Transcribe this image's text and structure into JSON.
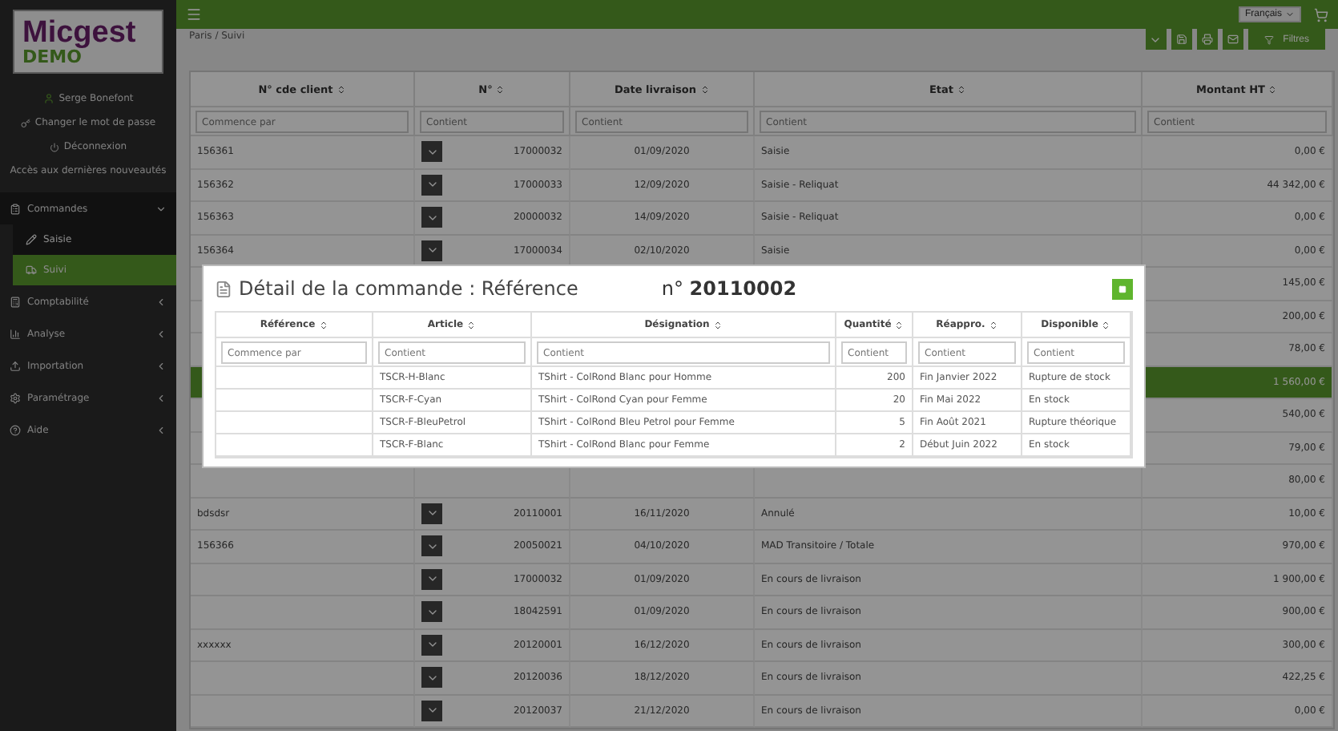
{
  "sidebar": {
    "logo": {
      "name": "Micgest",
      "sub": "DEMO"
    },
    "user": "Serge Bonefont",
    "links": [
      "Changer le mot de passe",
      "Déconnexion"
    ],
    "note": "Accès aux dernières nouveautés",
    "items": [
      {
        "label": "Commandes",
        "expanded": true,
        "children": [
          {
            "label": "Saisie",
            "selected": false
          },
          {
            "label": "Suivi",
            "selected": true
          }
        ]
      },
      {
        "label": "Comptabilité",
        "expanded": false
      },
      {
        "label": "Analyse",
        "expanded": false
      },
      {
        "label": "Importation",
        "expanded": false
      },
      {
        "label": "Paramétrage",
        "expanded": false
      },
      {
        "label": "Aide",
        "expanded": false
      }
    ]
  },
  "topbar": {
    "language": "Français"
  },
  "breadcrumb": "Paris / Suivi",
  "toolbar": {
    "filter_button": "Filtres"
  },
  "table": {
    "columns": [
      "N° cde client",
      "N°",
      "Date livraison",
      "Etat",
      "Montant HT"
    ],
    "filters": [
      {
        "placeholder": "Commence par"
      },
      {
        "placeholder": "Contient"
      },
      {
        "placeholder": "Contient"
      },
      {
        "placeholder": "Contient"
      },
      {
        "placeholder": "Contient"
      }
    ],
    "rows": [
      {
        "client": "156361",
        "number": "17000032",
        "date": "01/09/2020",
        "status": "Saisie",
        "amount": "0,00 €",
        "selected": false
      },
      {
        "client": "156362",
        "number": "17000033",
        "date": "12/09/2020",
        "status": "Saisie - Reliquat",
        "amount": "44 342,00 €",
        "selected": false
      },
      {
        "client": "156363",
        "number": "20000032",
        "date": "14/09/2020",
        "status": "Saisie - Reliquat",
        "amount": "0,00 €",
        "selected": false
      },
      {
        "client": "156364",
        "number": "17000034",
        "date": "02/10/2020",
        "status": "Saisie",
        "amount": "0,00 €",
        "selected": false
      },
      {
        "amount": "145,00 €",
        "selected": false
      },
      {
        "amount": "200,00 €",
        "selected": false
      },
      {
        "amount": "78,00 €",
        "selected": false
      },
      {
        "amount": "1 560,00 €",
        "selected": true
      },
      {
        "amount": "540,00 €",
        "selected": false
      },
      {
        "amount": "79,00 €",
        "selected": false
      },
      {
        "amount": "80,00 €",
        "selected": false
      },
      {
        "client": "bdsdsr",
        "number": "20110001",
        "date": "16/11/2020",
        "status": "Annulé",
        "amount": "10,00 €",
        "selected": false
      },
      {
        "client": "156366",
        "number": "20050021",
        "date": "04/10/2020",
        "status": "MAD Transitoire / Totale",
        "amount": "970,00 €",
        "selected": false
      },
      {
        "number": "17000032",
        "date": "01/09/2020",
        "status": "En cours de livraison",
        "amount": "1 900,00 €",
        "selected": false
      },
      {
        "number": "18042591",
        "date": "01/09/2020",
        "status": "En cours de livraison",
        "amount": "900,00 €",
        "selected": false
      },
      {
        "client": "xxxxxx",
        "number": "20120001",
        "date": "16/12/2020",
        "status": "En cours de livraison",
        "amount": "300,00 €",
        "selected": false
      },
      {
        "number": "20120036",
        "date": "18/12/2020",
        "status": "En cours de livraison",
        "amount": "422,25 €",
        "selected": false
      },
      {
        "number": "20120037",
        "date": "21/12/2020",
        "status": "En cours de livraison",
        "amount": "0,00 €",
        "selected": false
      }
    ]
  },
  "modal": {
    "title": "Détail de la commande : Référence",
    "order": "n° **20110002**",
    "columns": [
      "Référence",
      "Article",
      "Désignation",
      "Quantité",
      "Réappro.",
      "Disponible"
    ],
    "filters": [
      {
        "placeholder": "Commence par"
      },
      {
        "placeholder": "Contient"
      },
      {
        "placeholder": "Contient"
      },
      {
        "placeholder": "Contient"
      },
      {
        "placeholder": "Contient"
      },
      {
        "placeholder": "Contient"
      }
    ],
    "rows": [
      {
        "article": "TSCR-H-Blanc",
        "designation": "TShirt - ColRond Blanc pour Homme",
        "quantity": "200",
        "restock": "Fin Janvier 2022",
        "availability": "Rupture de stock"
      },
      {
        "article": "TSCR-F-Cyan",
        "designation": "TShirt - ColRond Cyan pour Femme",
        "quantity": "20",
        "restock": "Fin Mai 2022",
        "availability": "En stock"
      },
      {
        "article": "TSCR-F-BleuPetrol",
        "designation": "TShirt - ColRond Bleu Petrol pour Femme",
        "quantity": "5",
        "restock": "Fin Août 2021",
        "availability": "Rupture théorique"
      },
      {
        "article": "TSCR-F-Blanc",
        "designation": "TShirt - ColRond Blanc pour Femme",
        "quantity": "2",
        "restock": "Début Juin 2022",
        "availability": "En stock"
      }
    ]
  }
}
